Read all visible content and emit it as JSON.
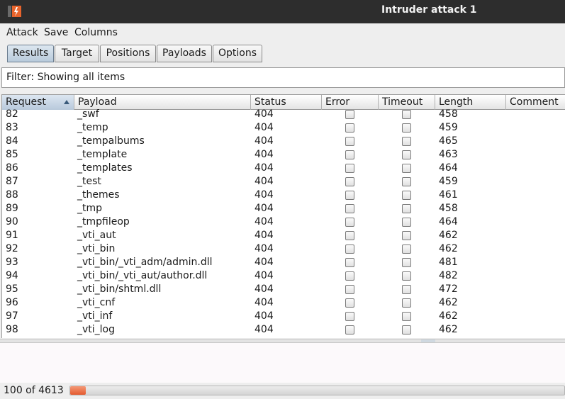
{
  "window": {
    "title": "Intruder attack 1"
  },
  "menu": [
    "Attack",
    "Save",
    "Columns"
  ],
  "tabs": [
    "Results",
    "Target",
    "Positions",
    "Payloads",
    "Options"
  ],
  "active_tab": "Results",
  "filter": {
    "label": "Filter: Showing all items"
  },
  "table": {
    "columns": [
      "Request",
      "Payload",
      "Status",
      "Error",
      "Timeout",
      "Length",
      "Comment"
    ],
    "sorted_column": "Request",
    "rows": [
      {
        "request": "82",
        "payload": "_swf",
        "status": "404",
        "error": false,
        "timeout": false,
        "length": "458",
        "comment": ""
      },
      {
        "request": "83",
        "payload": "_temp",
        "status": "404",
        "error": false,
        "timeout": false,
        "length": "459",
        "comment": ""
      },
      {
        "request": "84",
        "payload": "_tempalbums",
        "status": "404",
        "error": false,
        "timeout": false,
        "length": "465",
        "comment": ""
      },
      {
        "request": "85",
        "payload": "_template",
        "status": "404",
        "error": false,
        "timeout": false,
        "length": "463",
        "comment": ""
      },
      {
        "request": "86",
        "payload": "_templates",
        "status": "404",
        "error": false,
        "timeout": false,
        "length": "464",
        "comment": ""
      },
      {
        "request": "87",
        "payload": "_test",
        "status": "404",
        "error": false,
        "timeout": false,
        "length": "459",
        "comment": ""
      },
      {
        "request": "88",
        "payload": "_themes",
        "status": "404",
        "error": false,
        "timeout": false,
        "length": "461",
        "comment": ""
      },
      {
        "request": "89",
        "payload": "_tmp",
        "status": "404",
        "error": false,
        "timeout": false,
        "length": "458",
        "comment": ""
      },
      {
        "request": "90",
        "payload": "_tmpfileop",
        "status": "404",
        "error": false,
        "timeout": false,
        "length": "464",
        "comment": ""
      },
      {
        "request": "91",
        "payload": "_vti_aut",
        "status": "404",
        "error": false,
        "timeout": false,
        "length": "462",
        "comment": ""
      },
      {
        "request": "92",
        "payload": "_vti_bin",
        "status": "404",
        "error": false,
        "timeout": false,
        "length": "462",
        "comment": ""
      },
      {
        "request": "93",
        "payload": "_vti_bin/_vti_adm/admin.dll",
        "status": "404",
        "error": false,
        "timeout": false,
        "length": "481",
        "comment": ""
      },
      {
        "request": "94",
        "payload": "_vti_bin/_vti_aut/author.dll",
        "status": "404",
        "error": false,
        "timeout": false,
        "length": "482",
        "comment": ""
      },
      {
        "request": "95",
        "payload": "_vti_bin/shtml.dll",
        "status": "404",
        "error": false,
        "timeout": false,
        "length": "472",
        "comment": ""
      },
      {
        "request": "96",
        "payload": "_vti_cnf",
        "status": "404",
        "error": false,
        "timeout": false,
        "length": "462",
        "comment": ""
      },
      {
        "request": "97",
        "payload": "_vti_inf",
        "status": "404",
        "error": false,
        "timeout": false,
        "length": "462",
        "comment": ""
      },
      {
        "request": "98",
        "payload": "_vti_log",
        "status": "404",
        "error": false,
        "timeout": false,
        "length": "462",
        "comment": ""
      }
    ]
  },
  "status": {
    "count_text": "100 of 4613",
    "progress_fraction": 0.0217
  },
  "colors": {
    "titlebar": "#2d2d2d",
    "progress": "#e45a2e",
    "active_tab": "#b8cadb"
  },
  "icons": {
    "app": "burp-logo-icon",
    "sort": "sort-ascending-icon",
    "checkbox": "checkbox-icon"
  }
}
